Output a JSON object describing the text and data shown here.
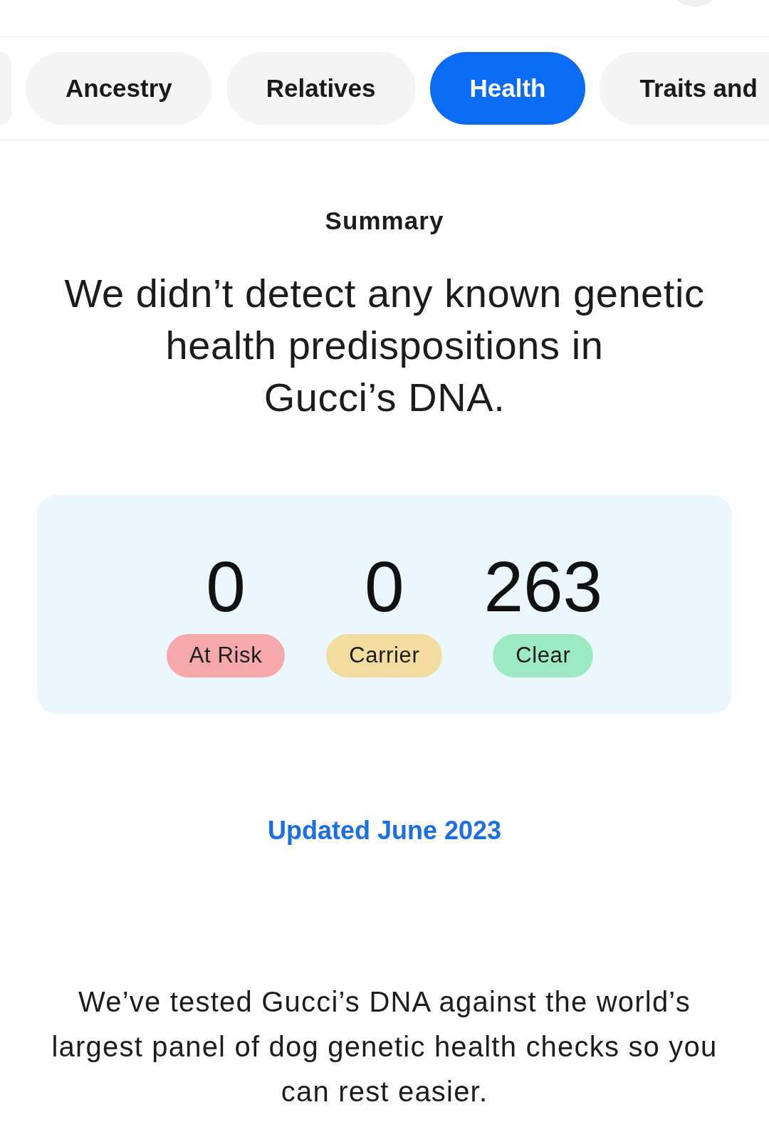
{
  "tabs": [
    {
      "label": "Ancestry",
      "selected": false
    },
    {
      "label": "Relatives",
      "selected": false
    },
    {
      "label": "Health",
      "selected": true
    },
    {
      "label": "Traits and",
      "selected": false
    }
  ],
  "summary": {
    "title": "Summary",
    "headline_lines": [
      "We didn’t detect any known genetic",
      "health predispositions in",
      "Gucci’s DNA."
    ],
    "counts": [
      {
        "value": "0",
        "label": "At Risk",
        "color": "#f7a8aa"
      },
      {
        "value": "0",
        "label": "Carrier",
        "color": "#f3dca0"
      },
      {
        "value": "263",
        "label": "Clear",
        "color": "#9de9c4"
      }
    ],
    "updated_link": "Updated June 2023",
    "body_lines": [
      "We’ve tested Gucci’s DNA against the world’s",
      "largest panel of dog genetic health checks so you",
      "can rest easier."
    ]
  }
}
